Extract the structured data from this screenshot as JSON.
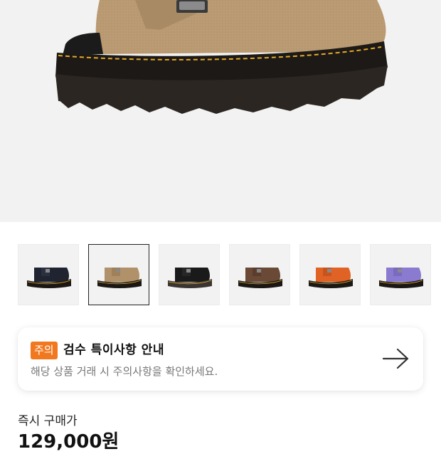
{
  "product": {
    "main_image_alt": "Tan suede clog with buckle strap and yellow-stitched chunky sole",
    "thumbnails": [
      {
        "name": "black-navy",
        "upper": "#1f2430",
        "selected": false
      },
      {
        "name": "tan",
        "upper": "#b0916a",
        "selected": true
      },
      {
        "name": "black",
        "upper": "#1a1a1a",
        "selected": false
      },
      {
        "name": "brown",
        "upper": "#6a4a36",
        "selected": false
      },
      {
        "name": "orange",
        "upper": "#e06225",
        "selected": false
      },
      {
        "name": "purple",
        "upper": "#8a7ad0",
        "selected": false
      }
    ]
  },
  "notice": {
    "tag": "주의",
    "title": "검수 특이사항 안내",
    "subtitle": "해당 상품 거래 시 주의사항을 확인하세요.",
    "icon": "arrow-right-icon"
  },
  "purchase": {
    "label": "즉시 구매가",
    "price": "129,000원"
  },
  "colors": {
    "accent": "#f2781f",
    "stitch": "#e6a92a"
  }
}
